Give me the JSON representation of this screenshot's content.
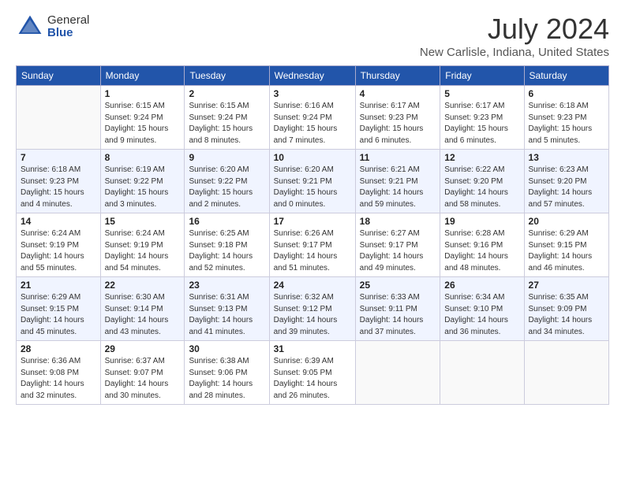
{
  "logo": {
    "general": "General",
    "blue": "Blue"
  },
  "title": "July 2024",
  "subtitle": "New Carlisle, Indiana, United States",
  "headers": [
    "Sunday",
    "Monday",
    "Tuesday",
    "Wednesday",
    "Thursday",
    "Friday",
    "Saturday"
  ],
  "weeks": [
    [
      {
        "num": "",
        "info": ""
      },
      {
        "num": "1",
        "info": "Sunrise: 6:15 AM\nSunset: 9:24 PM\nDaylight: 15 hours\nand 9 minutes."
      },
      {
        "num": "2",
        "info": "Sunrise: 6:15 AM\nSunset: 9:24 PM\nDaylight: 15 hours\nand 8 minutes."
      },
      {
        "num": "3",
        "info": "Sunrise: 6:16 AM\nSunset: 9:24 PM\nDaylight: 15 hours\nand 7 minutes."
      },
      {
        "num": "4",
        "info": "Sunrise: 6:17 AM\nSunset: 9:23 PM\nDaylight: 15 hours\nand 6 minutes."
      },
      {
        "num": "5",
        "info": "Sunrise: 6:17 AM\nSunset: 9:23 PM\nDaylight: 15 hours\nand 6 minutes."
      },
      {
        "num": "6",
        "info": "Sunrise: 6:18 AM\nSunset: 9:23 PM\nDaylight: 15 hours\nand 5 minutes."
      }
    ],
    [
      {
        "num": "7",
        "info": "Sunrise: 6:18 AM\nSunset: 9:23 PM\nDaylight: 15 hours\nand 4 minutes."
      },
      {
        "num": "8",
        "info": "Sunrise: 6:19 AM\nSunset: 9:22 PM\nDaylight: 15 hours\nand 3 minutes."
      },
      {
        "num": "9",
        "info": "Sunrise: 6:20 AM\nSunset: 9:22 PM\nDaylight: 15 hours\nand 2 minutes."
      },
      {
        "num": "10",
        "info": "Sunrise: 6:20 AM\nSunset: 9:21 PM\nDaylight: 15 hours\nand 0 minutes."
      },
      {
        "num": "11",
        "info": "Sunrise: 6:21 AM\nSunset: 9:21 PM\nDaylight: 14 hours\nand 59 minutes."
      },
      {
        "num": "12",
        "info": "Sunrise: 6:22 AM\nSunset: 9:20 PM\nDaylight: 14 hours\nand 58 minutes."
      },
      {
        "num": "13",
        "info": "Sunrise: 6:23 AM\nSunset: 9:20 PM\nDaylight: 14 hours\nand 57 minutes."
      }
    ],
    [
      {
        "num": "14",
        "info": "Sunrise: 6:24 AM\nSunset: 9:19 PM\nDaylight: 14 hours\nand 55 minutes."
      },
      {
        "num": "15",
        "info": "Sunrise: 6:24 AM\nSunset: 9:19 PM\nDaylight: 14 hours\nand 54 minutes."
      },
      {
        "num": "16",
        "info": "Sunrise: 6:25 AM\nSunset: 9:18 PM\nDaylight: 14 hours\nand 52 minutes."
      },
      {
        "num": "17",
        "info": "Sunrise: 6:26 AM\nSunset: 9:17 PM\nDaylight: 14 hours\nand 51 minutes."
      },
      {
        "num": "18",
        "info": "Sunrise: 6:27 AM\nSunset: 9:17 PM\nDaylight: 14 hours\nand 49 minutes."
      },
      {
        "num": "19",
        "info": "Sunrise: 6:28 AM\nSunset: 9:16 PM\nDaylight: 14 hours\nand 48 minutes."
      },
      {
        "num": "20",
        "info": "Sunrise: 6:29 AM\nSunset: 9:15 PM\nDaylight: 14 hours\nand 46 minutes."
      }
    ],
    [
      {
        "num": "21",
        "info": "Sunrise: 6:29 AM\nSunset: 9:15 PM\nDaylight: 14 hours\nand 45 minutes."
      },
      {
        "num": "22",
        "info": "Sunrise: 6:30 AM\nSunset: 9:14 PM\nDaylight: 14 hours\nand 43 minutes."
      },
      {
        "num": "23",
        "info": "Sunrise: 6:31 AM\nSunset: 9:13 PM\nDaylight: 14 hours\nand 41 minutes."
      },
      {
        "num": "24",
        "info": "Sunrise: 6:32 AM\nSunset: 9:12 PM\nDaylight: 14 hours\nand 39 minutes."
      },
      {
        "num": "25",
        "info": "Sunrise: 6:33 AM\nSunset: 9:11 PM\nDaylight: 14 hours\nand 37 minutes."
      },
      {
        "num": "26",
        "info": "Sunrise: 6:34 AM\nSunset: 9:10 PM\nDaylight: 14 hours\nand 36 minutes."
      },
      {
        "num": "27",
        "info": "Sunrise: 6:35 AM\nSunset: 9:09 PM\nDaylight: 14 hours\nand 34 minutes."
      }
    ],
    [
      {
        "num": "28",
        "info": "Sunrise: 6:36 AM\nSunset: 9:08 PM\nDaylight: 14 hours\nand 32 minutes."
      },
      {
        "num": "29",
        "info": "Sunrise: 6:37 AM\nSunset: 9:07 PM\nDaylight: 14 hours\nand 30 minutes."
      },
      {
        "num": "30",
        "info": "Sunrise: 6:38 AM\nSunset: 9:06 PM\nDaylight: 14 hours\nand 28 minutes."
      },
      {
        "num": "31",
        "info": "Sunrise: 6:39 AM\nSunset: 9:05 PM\nDaylight: 14 hours\nand 26 minutes."
      },
      {
        "num": "",
        "info": ""
      },
      {
        "num": "",
        "info": ""
      },
      {
        "num": "",
        "info": ""
      }
    ]
  ]
}
